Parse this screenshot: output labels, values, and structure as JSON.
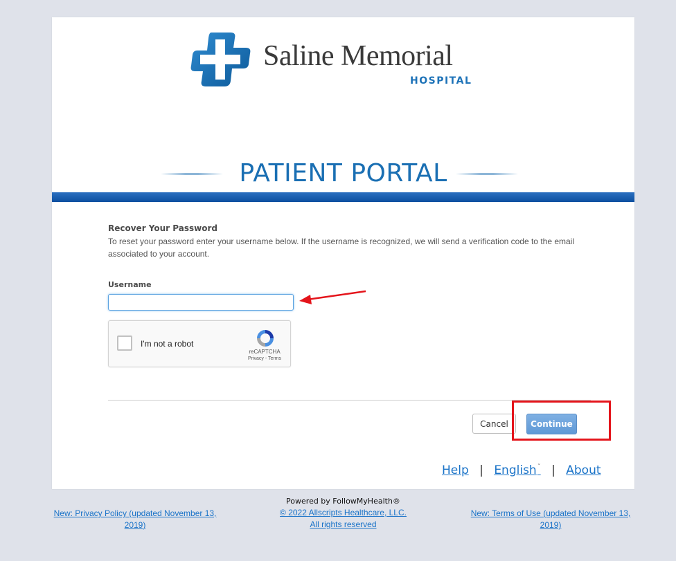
{
  "brand": {
    "name": "Saline Memorial",
    "sub": "HOSPITAL",
    "logo_color": "#1e73b8"
  },
  "portal_title": "PATIENT PORTAL",
  "recover": {
    "heading": "Recover Your Password",
    "description": "To reset your password enter your username below. If the username is recognized, we will send a verification code to the email associated to your account."
  },
  "form": {
    "username_label": "Username",
    "username_value": "",
    "username_placeholder": ""
  },
  "recaptcha": {
    "label": "I'm not a robot",
    "brand": "reCAPTCHA",
    "links": "Privacy - Terms"
  },
  "buttons": {
    "cancel": "Cancel",
    "continue": "Continue"
  },
  "footer_nav": {
    "help": "Help",
    "language": "English",
    "about": "About",
    "separator": "|"
  },
  "bottom": {
    "privacy": "New: Privacy Policy (updated November 13, 2019)",
    "powered": "Powered by FollowMyHealth®",
    "copyright": "© 2022 Allscripts Healthcare, LLC.",
    "rights": "All rights reserved",
    "terms": "New: Terms of Use (updated November 13, 2019)"
  },
  "annotations": {
    "arrow_color": "#e4141b",
    "highlight_color": "#e4141b"
  }
}
